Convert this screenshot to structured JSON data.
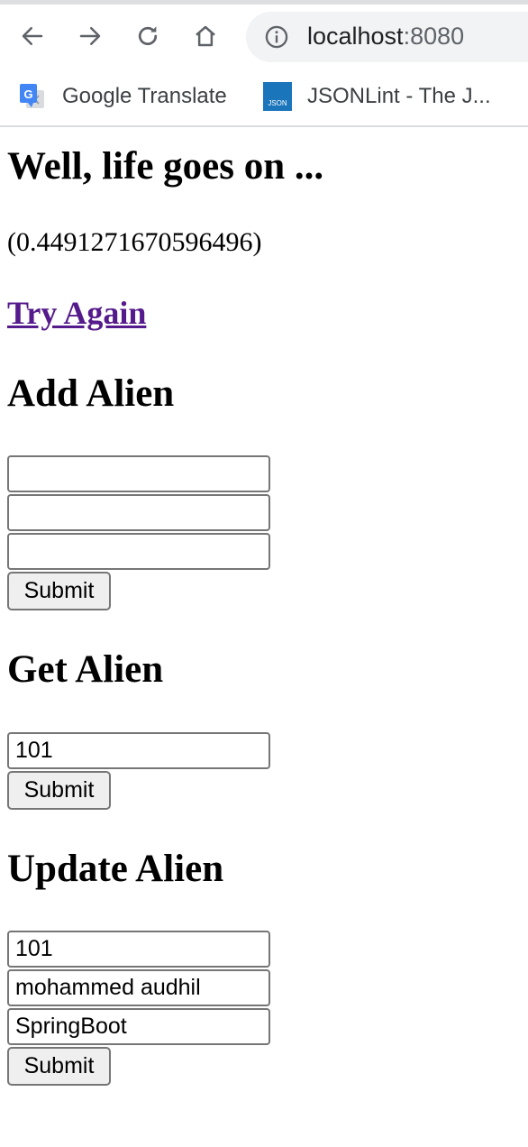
{
  "browser": {
    "url_host": "localhost",
    "url_port": ":8080",
    "bookmarks": [
      {
        "label": "Google Translate",
        "icon": "google-translate-icon"
      },
      {
        "label": "JSONLint - The J...",
        "icon": "jsonlint-icon",
        "icon_text": "JSON"
      }
    ]
  },
  "page": {
    "heading": "Well, life goes on ...",
    "random_value": "(0.4491271670596496)",
    "try_again_link": "Try Again",
    "link_color": "#551a8b"
  },
  "add_alien": {
    "heading": "Add Alien",
    "fields": [
      "",
      "",
      ""
    ],
    "submit_label": "Submit"
  },
  "get_alien": {
    "heading": "Get Alien",
    "id_value": "101",
    "submit_label": "Submit"
  },
  "update_alien": {
    "heading": "Update Alien",
    "id_value": "101",
    "name_value": "mohammed audhil",
    "tech_value": "SpringBoot",
    "submit_label": "Submit"
  }
}
